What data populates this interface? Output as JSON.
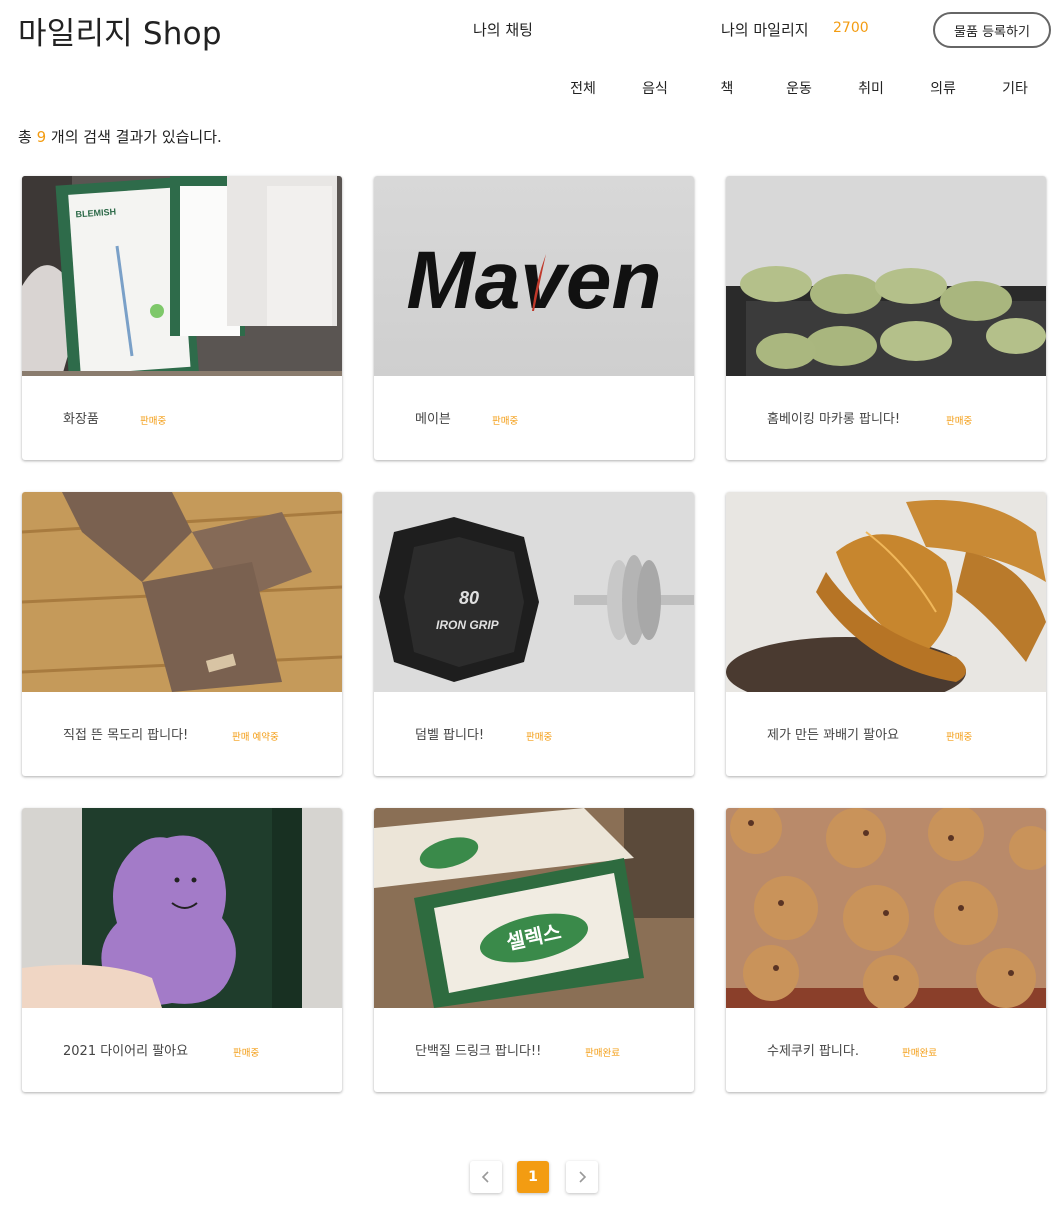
{
  "header": {
    "logo": "마일리지 Shop",
    "chat_link": "나의 채팅",
    "mileage_label": "나의 마일리지",
    "mileage_value": "2700",
    "register_button": "물품 등록하기"
  },
  "categories": [
    "전체",
    "음식",
    "책",
    "운동",
    "취미",
    "의류",
    "기타"
  ],
  "results": {
    "prefix": "총",
    "count": "9",
    "suffix": "개의 검색 결과가 있습니다."
  },
  "products": [
    {
      "title": "화장품",
      "status": "판매중"
    },
    {
      "title": "메이븐",
      "status": "판매중"
    },
    {
      "title": "홈베이킹 마카롱 팝니다!",
      "status": "판매중"
    },
    {
      "title": "직접 뜬 목도리 팝니다!",
      "status": "판매 예약중"
    },
    {
      "title": "덤벨 팝니다!",
      "status": "판매중"
    },
    {
      "title": "제가 만든 꽈배기 팔아요",
      "status": "판매중"
    },
    {
      "title": "2021 다이어리 팔아요",
      "status": "판매중"
    },
    {
      "title": "단백질 드링크 팝니다!!",
      "status": "판매완료"
    },
    {
      "title": "수제쿠키 팝니다.",
      "status": "판매완료"
    }
  ],
  "image_text": {
    "cosmetic_brand": "BLEMISH",
    "maven_logo": "Maven",
    "dumbbell_weight": "80",
    "dumbbell_brand": "IRON GRIP",
    "protein_brand": "셀렉스"
  },
  "pagination": {
    "current": "1",
    "prev_icon": "chevron-left-icon",
    "next_icon": "chevron-right-icon"
  },
  "colors": {
    "accent": "#f39c12",
    "text": "#222222",
    "border": "#666666"
  }
}
